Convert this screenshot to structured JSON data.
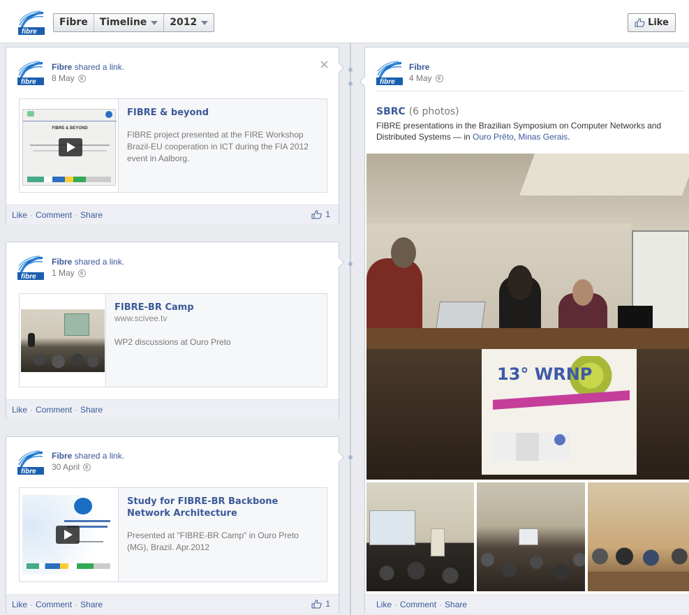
{
  "header": {
    "page_name": "Fibre",
    "timeline_label": "Timeline",
    "year_label": "2012",
    "like_button": "Like",
    "logo_text": "fibre"
  },
  "posts": [
    {
      "author": "Fibre",
      "action": " shared a link.",
      "date": "8 May",
      "close": "×",
      "link_title": "FIBRE & beyond",
      "link_desc": "FIBRE project presented at the FIRE Workshop Brazil-EU cooperation in ICT during the FIA 2012 event in Aalborg.",
      "thumb_heading": "FIBRE & BEYOND",
      "actions": [
        "Like",
        "Comment",
        "Share"
      ],
      "likes": "1"
    },
    {
      "author": "Fibre",
      "action": " shared a link.",
      "date": "1 May",
      "link_title": "FIBRE-BR Camp",
      "link_domain": "www.scivee.tv",
      "link_desc": "WP2 discussions at Ouro Preto",
      "actions": [
        "Like",
        "Comment",
        "Share"
      ]
    },
    {
      "author": "Fibre",
      "action": " shared a link.",
      "date": "30 April",
      "link_title": "Study for FIBRE-BR Backbone Network Architecture",
      "link_desc": "Presented at \"FIBRE-BR Camp\" in Ouro Preto (MG), Brazil. Apr.2012",
      "actions": [
        "Like",
        "Comment",
        "Share"
      ],
      "likes": "1"
    }
  ],
  "album_post": {
    "author": "Fibre",
    "date": "4 May",
    "album_name": "SBRC",
    "photo_count": "(6 photos)",
    "description": "FIBRE presentations in the Brazilian Symposium on Computer Networks and Distributed Systems — in ",
    "place1": "Ouro Prêto",
    "place_sep": ", ",
    "place2": "Minas Gerais",
    "place_end": ".",
    "banner_text": "13° WRNP",
    "actions": [
      "Like",
      "Comment",
      "Share"
    ]
  },
  "colors": {
    "link_blue": "#3b5998",
    "logo_blue": "#1a6fc4"
  }
}
